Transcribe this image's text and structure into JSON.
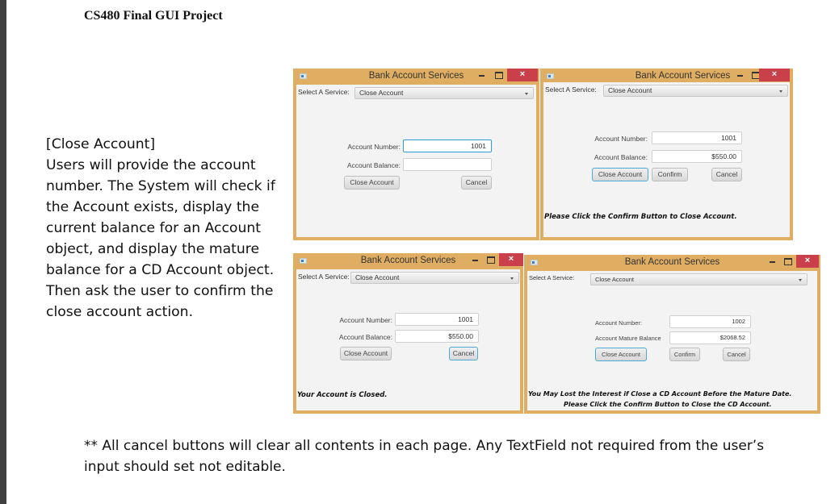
{
  "document": {
    "title": "CS480 Final GUI Project",
    "description_lines": [
      "[Close Account]",
      "Users will provide the account",
      "number. The System will check if",
      "the Account exists, display the",
      "current balance for an Account",
      "object, and display the mature",
      "balance for a CD Account object.",
      "Then ask the user to confirm the",
      "close account action."
    ],
    "footnote_lines": [
      "** All cancel buttons will clear all contents in each page. Any TextField not required from the user’s",
      "input should set not editable."
    ]
  },
  "colors": {
    "window_frame": "#e0ae63",
    "close_button": "#c9404a",
    "focus_border": "#3aa0d0"
  },
  "windows": [
    {
      "title": "Bank Account Services",
      "close_glyph": "×",
      "service_label": "Select A Service:",
      "service_value": "Close Account",
      "account_number_label": "Account Number:",
      "account_number_value": "1001",
      "balance_label": "Account Balance:",
      "balance_value": "",
      "close_account_label": "Close Account",
      "cancel_label": "Cancel",
      "message": ""
    },
    {
      "title": "Bank Account Services",
      "close_glyph": "×",
      "service_label": "Select A Service:",
      "service_value": "Close Account",
      "account_number_label": "Account Number:",
      "account_number_value": "1001",
      "balance_label": "Account Balance:",
      "balance_value": "$550.00",
      "close_account_label": "Close Account",
      "confirm_label": "Confirm",
      "cancel_label": "Cancel",
      "message": "Please Click the Confirm Button to Close Account."
    },
    {
      "title": "Bank Account Services",
      "close_glyph": "×",
      "service_label": "Select A Service:",
      "service_value": "Close Account",
      "account_number_label": "Account Number:",
      "account_number_value": "1001",
      "balance_label": "Account Balance:",
      "balance_value": "$550.00",
      "close_account_label": "Close Account",
      "cancel_label": "Cancel",
      "message": "Your Account is Closed."
    },
    {
      "title": "Bank Account Services",
      "close_glyph": "×",
      "service_label": "Select A Service:",
      "service_value": "Close Account",
      "account_number_label": "Account Number:",
      "account_number_value": "1002",
      "balance_label": "Account Mature Balance",
      "balance_value": "$2068.52",
      "close_account_label": "Close Account",
      "confirm_label": "Confirm",
      "cancel_label": "Cancel",
      "message_line1": "You May Lost the Interest if Close a CD Account Before the Mature Date.",
      "message_line2": "Please Click the Confirm Button to Close the CD Account."
    }
  ]
}
